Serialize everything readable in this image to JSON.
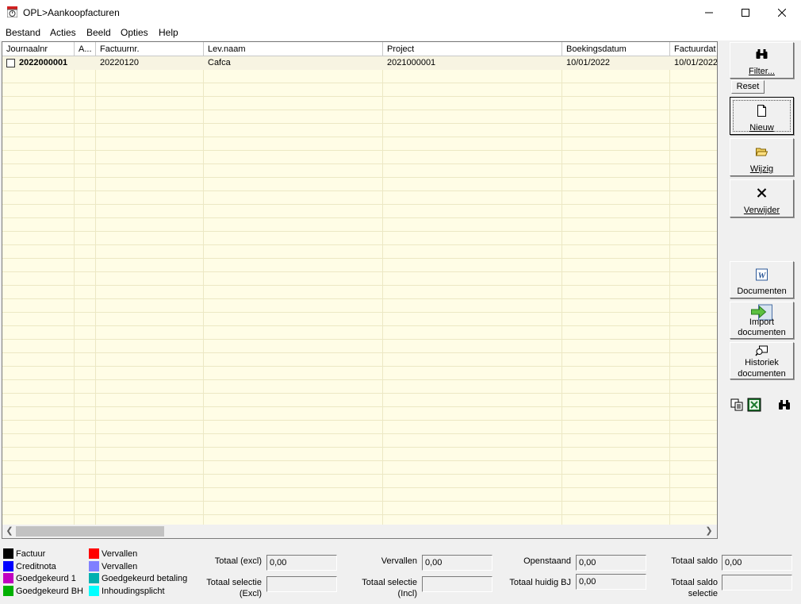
{
  "window": {
    "title": "OPL>Aankoopfacturen",
    "app_icon": "calendar-clock-icon"
  },
  "menu": [
    "Bestand",
    "Acties",
    "Beeld",
    "Opties",
    "Help"
  ],
  "grid": {
    "columns": [
      "Journaalnr",
      "A...",
      "Factuurnr.",
      "Lev.naam",
      "Project",
      "Boekingsdatum",
      "Factuurdat"
    ],
    "rows": [
      {
        "journaalnr": "2022000001",
        "a": "",
        "factuurnr": "20220120",
        "levnaam": "Cafca",
        "project": "2021000001",
        "boekingsdatum": "10/01/2022",
        "factuurdatum": "10/01/2022"
      }
    ]
  },
  "toolbar": {
    "filter": "Filter...",
    "reset": "Reset",
    "nieuw": "Nieuw",
    "wijzig": "Wijzig",
    "verwijder": "Verwijder",
    "documenten": "Documenten",
    "import_line1": "Import",
    "import_line2": "documenten",
    "historiek_line1": "Historiek",
    "historiek_line2": "documenten"
  },
  "legend": [
    {
      "label": "Factuur",
      "color": "#000000"
    },
    {
      "label": "Creditnota",
      "color": "#0000ff"
    },
    {
      "label": "Goedgekeurd 1",
      "color": "#c000c0"
    },
    {
      "label": "Goedgekeurd BH",
      "color": "#00b000"
    },
    {
      "label": "Vervallen",
      "color": "#ff0000"
    },
    {
      "label": "Vervallen",
      "color": "#8080ff"
    },
    {
      "label": "Goedgekeurd betaling",
      "color": "#00b0b0"
    },
    {
      "label": "Inhoudingsplicht",
      "color": "#00ffff"
    }
  ],
  "totals": {
    "totaal_excl": {
      "label": "Totaal (excl)",
      "value": "0,00"
    },
    "totaal_selectie_excl": {
      "label_line1": "Totaal selectie",
      "label_line2": "(Excl)",
      "value": ""
    },
    "vervallen": {
      "label": "Vervallen",
      "value": "0,00"
    },
    "totaal_selectie_incl": {
      "label_line1": "Totaal selectie",
      "label_line2": "(Incl)",
      "value": ""
    },
    "openstaand": {
      "label": "Openstaand",
      "value": "0,00"
    },
    "totaal_huidig_bj": {
      "label": "Totaal huidig BJ",
      "value": "0,00"
    },
    "totaal_saldo": {
      "label": "Totaal saldo",
      "value": "0,00"
    },
    "totaal_saldo_selectie": {
      "label_line1": "Totaal saldo",
      "label_line2": "selectie",
      "value": ""
    }
  },
  "colors": {
    "grid_background": "#fffde6",
    "window_background": "#f0f0f0"
  }
}
